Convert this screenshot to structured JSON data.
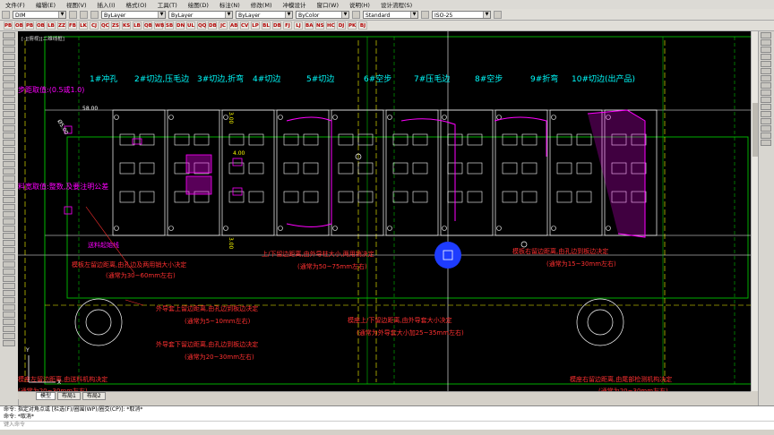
{
  "menu": [
    "文件(F)",
    "编辑(E)",
    "视图(V)",
    "插入(I)",
    "格式(O)",
    "工具(T)",
    "绘图(D)",
    "标注(N)",
    "修改(M)",
    "冲模设计",
    "窗口(W)",
    "说明(H)",
    "设计流程(S)"
  ],
  "toolbar": {
    "style_combo": "DIM",
    "layer_combo": "ByLayer",
    "linetype_combo": "ByLayer",
    "lineweight_combo": "ByLayer",
    "color_combo": "ByColor",
    "text_style": "Standard",
    "dim_style": "ISO-25"
  },
  "toolbar2_icons": [
    "PB",
    "OB",
    "PB",
    "OB",
    "LB",
    "ZZ",
    "FB",
    "LK",
    "CJ",
    "QC",
    "ZS",
    "KS",
    "LB",
    "QB",
    "WB",
    "SB",
    "DN",
    "UL",
    "QQ",
    "DB",
    "JC",
    "AB",
    "CV",
    "LP",
    "BL",
    "DB",
    "FJ",
    "LJ",
    "BA",
    "NS",
    "HC",
    "DJ",
    "PK",
    "BJ"
  ],
  "viewport_label": "[-][俯视][二维线框]",
  "drawing": {
    "station_labels": [
      "1#冲孔",
      "2#切边,压毛边",
      "3#切边,折弯",
      "4#切边",
      "5#切边",
      "6#空步",
      "7#压毛边",
      "8#空步",
      "9#折弯",
      "10#切边(出产品)"
    ],
    "note_pitch": "步距取值:(0.5或1.0)",
    "note_tolerance": "料宽取值:整数,及要注明公差",
    "dim_58": "58.00",
    "dim_05": "Ø5.00",
    "dim_3a": "3.00",
    "dim_4": "4.00",
    "dim_3b": "3.00",
    "feed_line": "送料起始线",
    "annotations": [
      "模板左留边距离,由孔边及两用销大小决定",
      "(通常为30~60mm左右)",
      "上/下留边距离,由外导柱大小,两用销决定",
      "(通常为50~75mm左右)",
      "模板右留边距离,由孔边到板边决定",
      "(通常为15~30mm左右)",
      "外导套上留边距离,由孔边到板边决定",
      "(通常为5~10mm左右)",
      "模座上/下留边距离,由外导套大小决定",
      "(通常为外导套大小加25~35mm左右)",
      "外导套下留边距离,由孔边到板边决定",
      "(通常为20~30mm左右)",
      "模座左留边距离,由送料机构决定",
      "(通常为20~30mm左右)",
      "模座右留边距离,由尾部检测机构决定",
      "(通常为20~30mm左右)"
    ],
    "axis_y": "Y",
    "axis_x": "X"
  },
  "tabs": [
    "模型",
    "布局1",
    "布局2"
  ],
  "command_lines": [
    "命令: 指定对角点或 [栏选(F)/圈围(WP)/圈交(CP)]: *取消*",
    "命令: *取消*",
    "键入命令"
  ],
  "colors": {
    "canvas_bg": "#000000",
    "cyan": "#00ffff",
    "magenta": "#ff00ff",
    "red": "#ff3030",
    "yellow": "#ffff00",
    "green": "#00c000",
    "white": "#ffffff",
    "cursor_blue": "#1e3cff"
  }
}
